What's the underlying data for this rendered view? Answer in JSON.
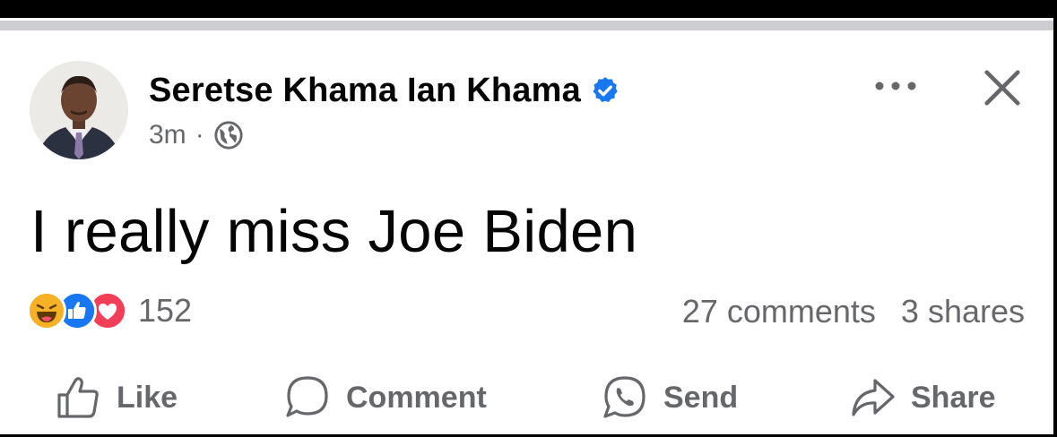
{
  "post": {
    "author": "Seretse Khama Ian Khama",
    "verified": true,
    "time": "3m",
    "separator": "·",
    "audience_icon": "globe-icon",
    "text": "I really miss Joe Biden"
  },
  "header_actions": {
    "more_icon": "more-horizontal-icon",
    "close_icon": "close-icon"
  },
  "reactions": {
    "icons": [
      "haha-icon",
      "like-reaction-icon",
      "love-icon"
    ],
    "count": "152"
  },
  "stats": {
    "comments": "27 comments",
    "shares": "3 shares"
  },
  "actions": {
    "like": "Like",
    "comment": "Comment",
    "send": "Send",
    "share": "Share"
  },
  "colors": {
    "verified": "#1877f2",
    "like_reaction": "#1877f2",
    "love_reaction": "#f33e58",
    "haha_reaction": "#f7b125",
    "secondary_text": "#65676b"
  }
}
